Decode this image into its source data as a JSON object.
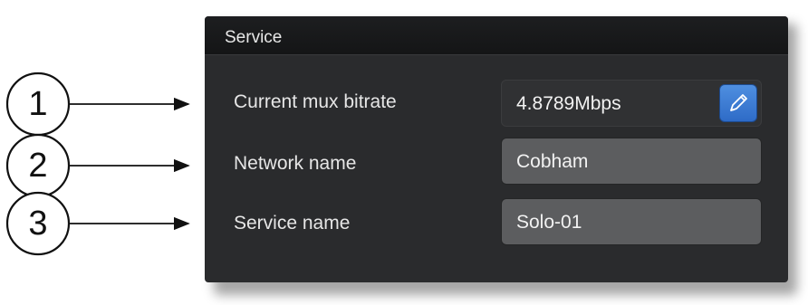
{
  "callouts": [
    "1",
    "2",
    "3"
  ],
  "panel": {
    "title": "Service",
    "rows": [
      {
        "label": "Current mux bitrate",
        "value": "4.8789Mbps",
        "editable": false,
        "action_icon": "pencil-edit-icon"
      },
      {
        "label": "Network name",
        "value": "Cobham",
        "editable": true
      },
      {
        "label": "Service name",
        "value": "Solo-01",
        "editable": true
      }
    ]
  },
  "colors": {
    "panel_bg": "#2a2b2d",
    "header_bg": "#161718",
    "editable_field_bg": "#5c5d5f",
    "edit_button": "#3b7bd4"
  }
}
